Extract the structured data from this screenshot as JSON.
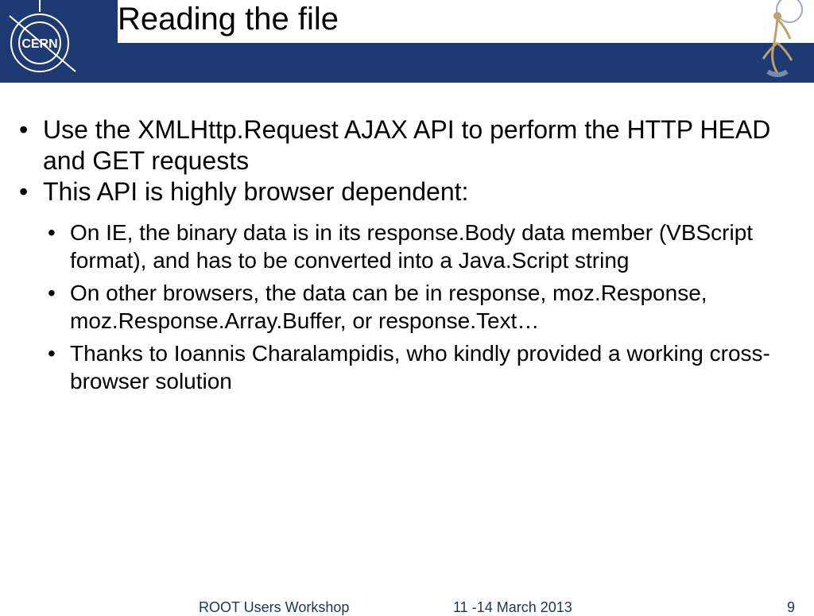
{
  "header": {
    "title": "Reading the file"
  },
  "bullets": {
    "b1": "Use the XMLHttp.Request AJAX API to perform the HTTP HEAD and GET requests",
    "b2": "This API is highly browser dependent:",
    "sub1": "On IE, the binary data is in its response.Body data member (VBScript format), and has to be converted into a Java.Script string",
    "sub2": "On other browsers, the data can be in response, moz.Response, moz.Response.Array.Buffer, or response.Text…",
    "sub3": "Thanks to Ioannis Charalampidis, who kindly provided a working cross-browser solution"
  },
  "footer": {
    "event": "ROOT Users Workshop",
    "date": "11 -14 March 2013",
    "page": "9"
  }
}
